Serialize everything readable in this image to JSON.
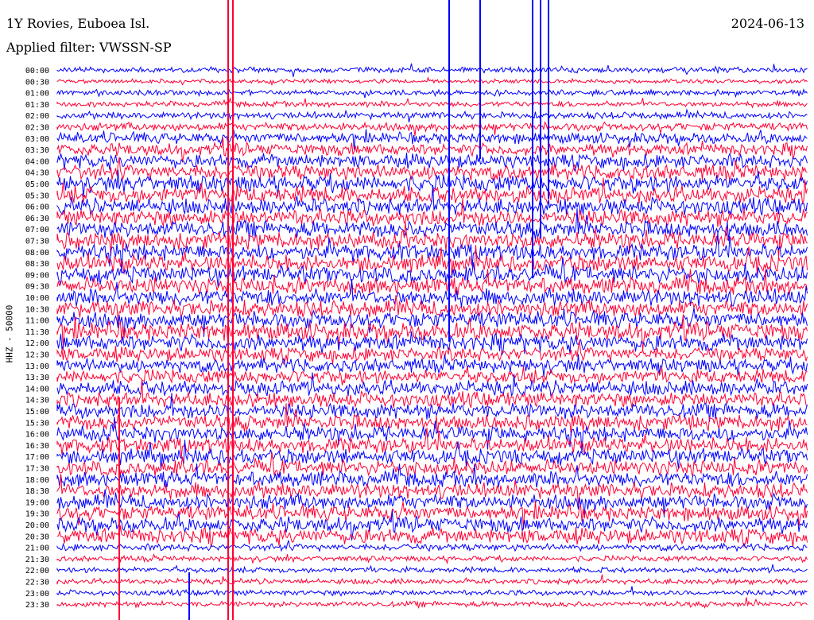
{
  "header": {
    "title": "1Y Rovies, Euboea Isl.",
    "filter": "Applied filter: VWSSN-SP",
    "date": "2024-06-13"
  },
  "chart_data": {
    "type": "line",
    "title": "1Y Rovies, Euboea Isl.",
    "subtitle": "Applied filter: VWSSN-SP",
    "date": "2024-06-13",
    "ylabel": "HHZ - 50000",
    "row_labels": [
      "00:00",
      "00:30",
      "01:00",
      "01:30",
      "02:00",
      "02:30",
      "03:00",
      "03:30",
      "04:00",
      "04:30",
      "05:00",
      "05:30",
      "06:00",
      "06:30",
      "07:00",
      "07:30",
      "08:00",
      "08:30",
      "09:00",
      "09:30",
      "10:00",
      "10:30",
      "11:00",
      "11:30",
      "12:00",
      "12:30",
      "13:00",
      "13:30",
      "14:00",
      "14:30",
      "15:00",
      "15:30",
      "16:00",
      "16:30",
      "17:00",
      "17:30",
      "18:00",
      "18:30",
      "19:00",
      "19:30",
      "20:00",
      "20:30",
      "21:00",
      "21:30",
      "22:00",
      "22:30",
      "23:00",
      "23:30"
    ],
    "row_amplitude": [
      4,
      3,
      4,
      4,
      5,
      6,
      8,
      9,
      10,
      11,
      12,
      12,
      12,
      12,
      12,
      12,
      12,
      12,
      12,
      12,
      12,
      12,
      12,
      13,
      12,
      10,
      10,
      10,
      11,
      11,
      11,
      11,
      11,
      11,
      11,
      11,
      11,
      11,
      11,
      11,
      11,
      11,
      5,
      4,
      4,
      4,
      4,
      4
    ],
    "colors": {
      "odd_rows": "#0000ff",
      "even_rows": "#ff0033"
    },
    "grid": false
  }
}
